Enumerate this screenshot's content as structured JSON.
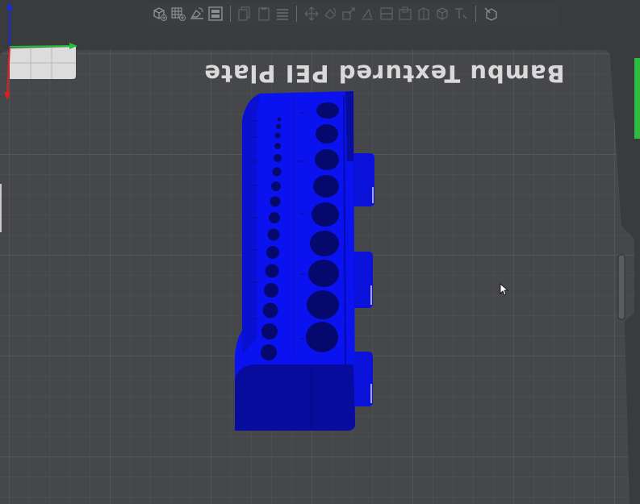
{
  "plate": {
    "label": "Bambu Textured PEI Plate",
    "colors": {
      "background": "#3a3b3d",
      "plate": "#45464a",
      "grid": "#55565a",
      "model": "#0b12f0",
      "model_shadow": "#060a8a",
      "toolbar": "#3c3d40",
      "icon": "#8d8e91",
      "edge_green": "#2ecc40"
    }
  },
  "toolbar": {
    "buttons": [
      {
        "name": "add-object-icon",
        "group": 1
      },
      {
        "name": "add-plate-icon",
        "group": 1
      },
      {
        "name": "auto-orient-icon",
        "group": 1
      },
      {
        "name": "arrange-icon",
        "group": 1
      },
      {
        "name": "copy-icon",
        "group": 1
      },
      {
        "name": "paste-icon",
        "group": 1
      },
      {
        "name": "layers-icon",
        "group": 1
      },
      {
        "name": "move-icon",
        "group": 2
      },
      {
        "name": "rotate-icon",
        "group": 2
      },
      {
        "name": "scale-icon",
        "group": 2
      },
      {
        "name": "lay-on-face-icon",
        "group": 2
      },
      {
        "name": "cut-icon",
        "group": 2
      },
      {
        "name": "support-paint-icon",
        "group": 2
      },
      {
        "name": "seam-paint-icon",
        "group": 2
      },
      {
        "name": "text-emboss-icon",
        "group": 2
      },
      {
        "name": "measure-icon",
        "group": 2
      },
      {
        "name": "assembly-view-icon",
        "group": 3
      }
    ]
  }
}
